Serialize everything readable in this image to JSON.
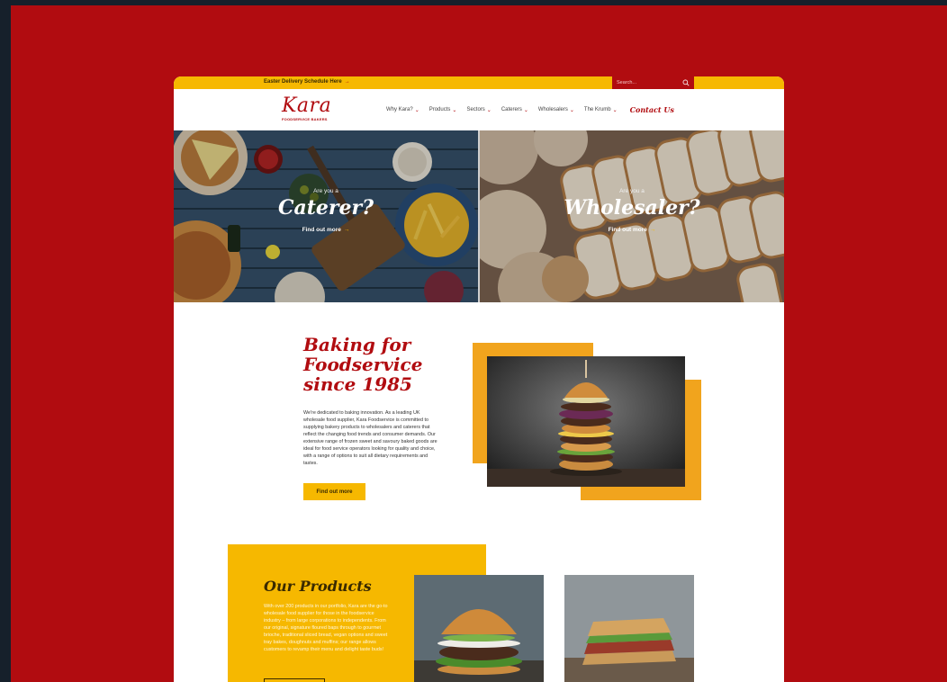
{
  "topbar": {
    "delivery_link": "Easter Delivery Schedule Here",
    "arrow": "→",
    "search_placeholder": "Search..."
  },
  "header": {
    "logo_word": "Kara",
    "logo_tagline": "FOODSERVICE BAKERS",
    "nav": [
      {
        "label": "Why Kara?"
      },
      {
        "label": "Products"
      },
      {
        "label": "Sectors"
      },
      {
        "label": "Caterers"
      },
      {
        "label": "Wholesalers"
      },
      {
        "label": "The Krumb"
      }
    ],
    "nav_chevron": "⌄",
    "contact": "Contact Us"
  },
  "hero": {
    "left": {
      "sub": "Are you a",
      "title": "Caterer?",
      "cta": "Find out more"
    },
    "right": {
      "sub": "Are you a",
      "title": "Wholesaler?",
      "cta": "Find out more"
    },
    "arrow": "→"
  },
  "about": {
    "title": "Baking for Foodservice since 1985",
    "body": "We're dedicated to baking innovation. As a leading UK wholesale food supplier, Kara Foodservice is committed to supplying bakery products to wholesalers and caterers that reflect the changing food trends and consumer demands. Our extensive range of frozen sweet and savoury baked goods are ideal for food service operators looking for quality and choice, with a range of options to suit all dietary requirements and tastes.",
    "cta": "Find out more"
  },
  "products": {
    "title": "Our Products",
    "body": "With over 200 products in our portfolio, Kara are the go-to wholesale food supplier for those in the foodservice industry – from large corporations to independents. From our original, signature floured baps through to gourmet brioche, traditional sliced bread, vegan options and sweet tray bakes, doughnuts and muffins; our range allows customers to revamp their menu and delight taste buds!"
  },
  "colors": {
    "brand_red": "#b10c10",
    "brand_yellow": "#f6b800",
    "accent_orange": "#f1a41d"
  }
}
